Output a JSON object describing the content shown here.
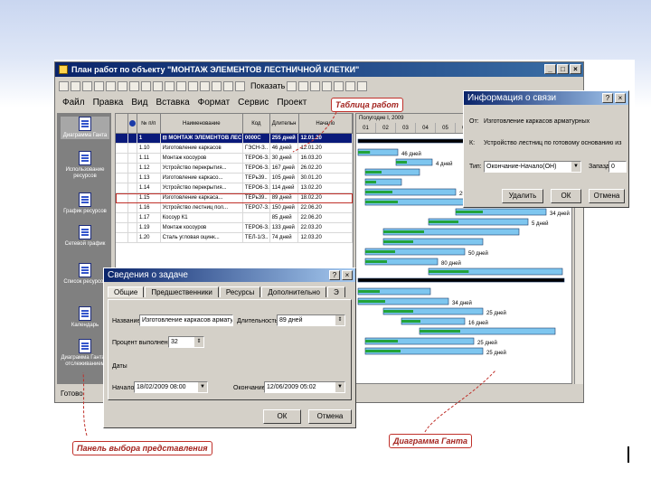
{
  "main_window": {
    "title": "План работ по объекту \"МОНТАЖ ЭЛЕМЕНТОВ ЛЕСТНИЧНОЙ КЛЕТКИ\"",
    "show_label": "Показать",
    "menu": [
      "Файл",
      "Правка",
      "Вид",
      "Вставка",
      "Формат",
      "Сервис",
      "Проект"
    ],
    "status": "Готово"
  },
  "sidepanel": {
    "items": [
      "Диаграмма Ганта",
      "Использование ресурсов",
      "График ресурсов",
      "Сетевой график",
      "Список ресурсов",
      "Календарь",
      "Диаграмма Ганта с отслеживанием"
    ]
  },
  "table": {
    "columns": [
      "",
      "",
      "№ п/п",
      "Наименование",
      "Код",
      "Длительн",
      "Начало"
    ],
    "rows": [
      [
        "",
        "",
        "1",
        "⊟ МОНТАЖ ЭЛЕМЕНТОВ ЛЕС",
        "0000С",
        "255 дней",
        "12.01.20"
      ],
      [
        "",
        "",
        "1.10",
        "Изготовление каркасов",
        "ГЭСН-З..",
        "46 дней",
        "12.01.20"
      ],
      [
        "",
        "",
        "1.11",
        "Монтаж косоуров",
        "ТЕРО6-З..",
        "30 дней",
        "16.03.20"
      ],
      [
        "",
        "",
        "1.12",
        "Устройство перекрытия...",
        "ТЕРО6-З..",
        "167 дней",
        "26.02.20"
      ],
      [
        "",
        "",
        "1.13",
        "Изготовление каркасо...",
        "ТЕРь39..",
        "105 дней",
        "30.01.20"
      ],
      [
        "",
        "",
        "1.14",
        "Устройство перекрытия...",
        "ТЕРО6-З..",
        "114 дней",
        "13.02.20"
      ],
      [
        "",
        "",
        "1.15",
        "Изготовление каркаса...",
        "ТЕРь39..",
        "89 дней",
        "18.02.20"
      ],
      [
        "",
        "",
        "1.16",
        "Устройство лестниц пол...",
        "ТЕРО7-З..",
        "150 дней",
        "22.06.20"
      ],
      [
        "",
        "",
        "1.17",
        "Косоур К1",
        "",
        "85 дней",
        "22.06.20"
      ],
      [
        "",
        "",
        "1.19",
        "Монтаж косоуров",
        "ТЕРО6-З..",
        "133 дней",
        "22.03.20"
      ],
      [
        "",
        "",
        "1.20",
        "Сталь угловая оцинк...",
        "ТЕЛ-1/З..",
        "74 дней",
        "12.03.20"
      ]
    ]
  },
  "gantt": {
    "period": "Полугодие I, 2009",
    "months": [
      "01",
      "02",
      "03",
      "04",
      "05",
      "06"
    ],
    "bar_labels": [
      "46 дней",
      "4 дней",
      "25 дней",
      "89 дней",
      "34 дней",
      "5 дней",
      "50 дней",
      "80 дней",
      "34 дней",
      "25 дней",
      "16 дней",
      "25 дней",
      "25 дней"
    ]
  },
  "link_dialog": {
    "title": "Информация о связи",
    "from_label": "От:",
    "from_value": "Изготовление каркасов арматурных",
    "to_label": "К:",
    "to_value": "Устройство лестниц по готовому основанию из",
    "type_label": "Тип:",
    "type_value": "Окончание-Начало(ОН)",
    "lag_label": "Запаздыв",
    "lag_value": "0",
    "delete_label": "Удалить",
    "ok_label": "ОК",
    "cancel_label": "Отмена"
  },
  "task_dialog": {
    "title": "Сведения о задаче",
    "tabs": [
      "Общие",
      "Предшественники",
      "Ресурсы",
      "Дополнительно",
      "Э"
    ],
    "name_label": "Название:",
    "name_value": "Изготовление каркасов арматурных",
    "duration_label": "Длительность:",
    "duration_value": "89 дней",
    "percent_label": "Процент выполнения:",
    "percent_value": "32",
    "dates_label": "Даты",
    "start_label": "Начало:",
    "start_value": "18/02/2009 08:00",
    "finish_label": "Окончание:",
    "finish_value": "12/06/2009 05:02",
    "ok_label": "ОК",
    "cancel_label": "Отмена"
  },
  "callouts": {
    "table": "Таблица работ",
    "panel": "Панель выбора представления",
    "gantt": "Диаграмма Ганта"
  }
}
